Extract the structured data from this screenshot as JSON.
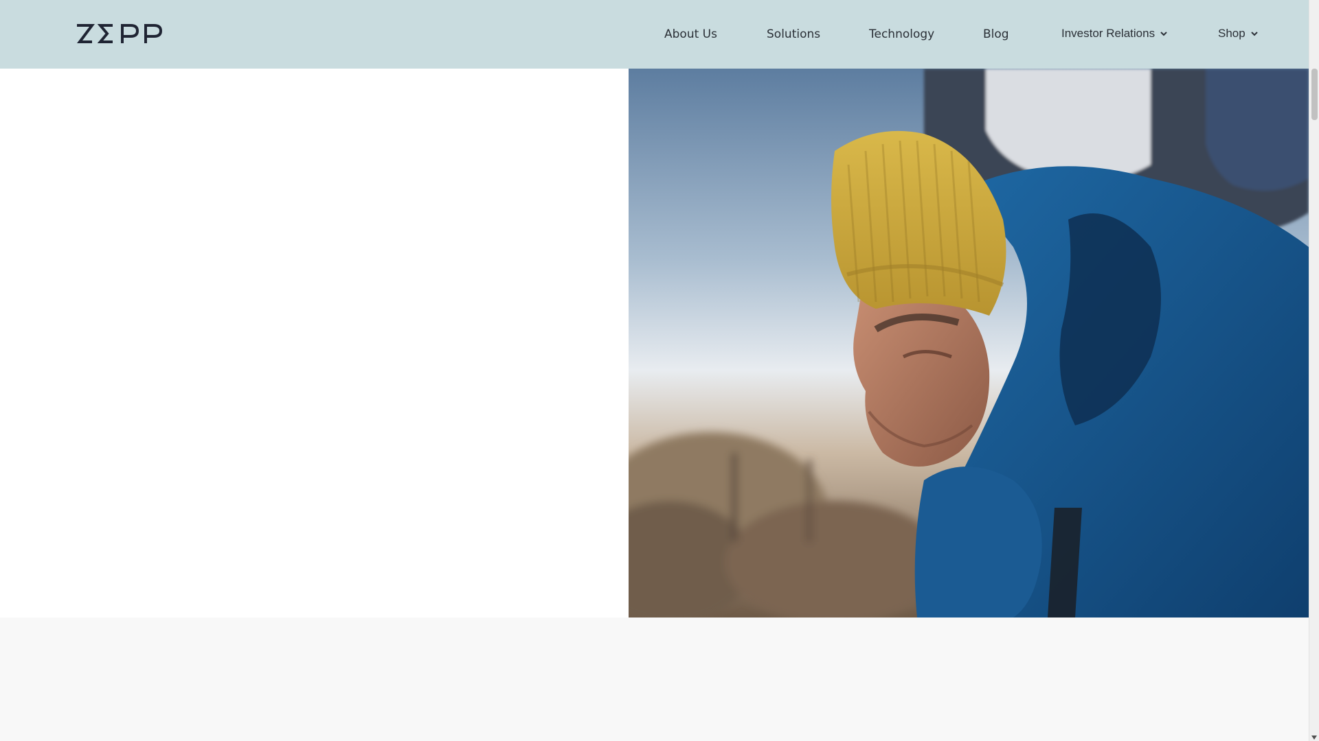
{
  "header": {
    "logo_alt": "ZEPP",
    "nav": [
      {
        "label": "About Us"
      },
      {
        "label": "Solutions"
      },
      {
        "label": "Technology"
      },
      {
        "label": "Blog"
      },
      {
        "label": "Investor Relations",
        "has_dropdown": true
      },
      {
        "label": "Shop",
        "has_dropdown": true
      }
    ]
  },
  "hero": {
    "media": "video",
    "pause_icon": "pause-icon"
  },
  "colors": {
    "header_bg": "#c9dcdf",
    "text": "#2a2f36",
    "logo": "#1f2433"
  }
}
